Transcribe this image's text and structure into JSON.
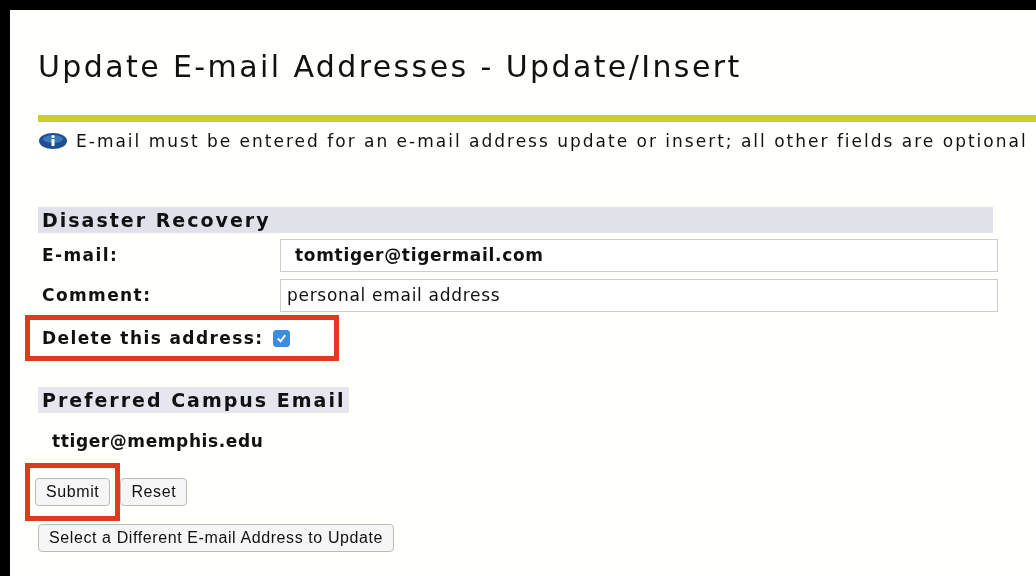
{
  "page": {
    "title": "Update E-mail Addresses - Update/Insert"
  },
  "info": {
    "text": "E-mail must be entered for an e-mail address update or insert; all other fields are optional"
  },
  "disaster_recovery": {
    "heading": "Disaster Recovery",
    "fields": [
      {
        "label": "E-mail:",
        "value": "tomtiger@tigermail.com",
        "bold": true
      },
      {
        "label": "Comment:",
        "value": "personal email address",
        "bold": false
      }
    ],
    "delete": {
      "label": "Delete this address:",
      "checked": true,
      "highlighted": true
    }
  },
  "preferred": {
    "heading": "Preferred Campus Email",
    "value": "ttiger@memphis.edu"
  },
  "buttons": [
    {
      "label": "Submit",
      "highlighted": true
    },
    {
      "label": "Reset",
      "highlighted": false
    }
  ],
  "select_button": {
    "label": "Select a Different E-mail Address to Update"
  }
}
